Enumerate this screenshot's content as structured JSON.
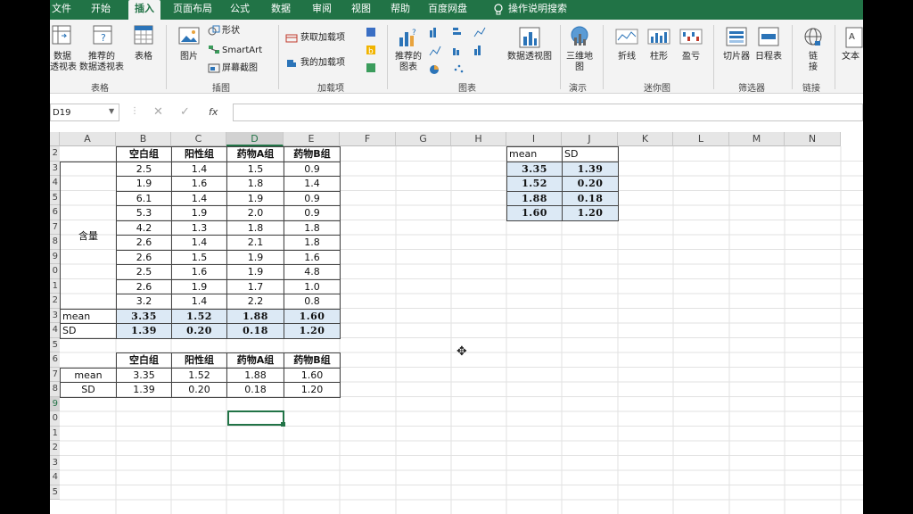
{
  "tabs": [
    "文件",
    "开始",
    "插入",
    "页面布局",
    "公式",
    "数据",
    "审阅",
    "视图",
    "帮助",
    "百度网盘",
    "操作说明搜索"
  ],
  "active_tab": "插入",
  "ribbon": {
    "pivot": "数据\n透视表",
    "recommended_pivot": "推荐的\n数据透视表",
    "table": "表格",
    "group_table": "表格",
    "picture": "图片",
    "shapes": "形状",
    "smartart": "SmartArt",
    "screenshot": "屏幕截图",
    "group_illustrations": "插图",
    "get_addins": "获取加载项",
    "my_addins": "我的加载项",
    "group_addins": "加载项",
    "recommended_charts": "推荐的\n图表",
    "pivot_chart": "数据透视图",
    "group_charts": "图表",
    "map3d": "三维地\n图",
    "group_tours": "演示",
    "line": "折线",
    "column": "柱形",
    "winloss": "盈亏",
    "group_sparklines": "迷你图",
    "slicer": "切片器",
    "timeline": "日程表",
    "group_filters": "筛选器",
    "link": "链\n接",
    "group_links": "链接",
    "text": "文本"
  },
  "namebox": "D19",
  "fx": "fx",
  "columns": [
    "A",
    "B",
    "C",
    "D",
    "E",
    "F",
    "G",
    "H",
    "I",
    "J",
    "K",
    "L",
    "M",
    "N"
  ],
  "selected_column": "D",
  "rows": [
    "2",
    "3",
    "4",
    "5",
    "6",
    "7",
    "8",
    "9",
    "0",
    "1",
    "2",
    "3",
    "4",
    "5",
    "6",
    "7",
    "8",
    "9",
    "0",
    "1",
    "2",
    "3",
    "4",
    "5"
  ],
  "selected_row_index": 17,
  "table1": {
    "headers": [
      "空白组",
      "阳性组",
      "药物A组",
      "药物B组"
    ],
    "group_label": "含量",
    "values": [
      [
        "2.5",
        "1.4",
        "1.5",
        "0.9"
      ],
      [
        "1.9",
        "1.6",
        "1.8",
        "1.4"
      ],
      [
        "6.1",
        "1.4",
        "1.9",
        "0.9"
      ],
      [
        "5.3",
        "1.9",
        "2.0",
        "0.9"
      ],
      [
        "4.2",
        "1.3",
        "1.8",
        "1.8"
      ],
      [
        "2.6",
        "1.4",
        "2.1",
        "1.8"
      ],
      [
        "2.6",
        "1.5",
        "1.9",
        "1.6"
      ],
      [
        "2.5",
        "1.6",
        "1.9",
        "4.8"
      ],
      [
        "2.6",
        "1.9",
        "1.7",
        "1.0"
      ],
      [
        "3.2",
        "1.4",
        "2.2",
        "0.8"
      ]
    ],
    "mean_label": "mean",
    "sd_label": "SD",
    "mean": [
      "3.35",
      "1.52",
      "1.88",
      "1.60"
    ],
    "sd": [
      "1.39",
      "0.20",
      "0.18",
      "1.20"
    ]
  },
  "table2": {
    "headers": [
      "空白组",
      "阳性组",
      "药物A组",
      "药物B组"
    ],
    "mean_label": "mean",
    "sd_label": "SD",
    "mean": [
      "3.35",
      "1.52",
      "1.88",
      "1.60"
    ],
    "sd": [
      "1.39",
      "0.20",
      "0.18",
      "1.20"
    ]
  },
  "table3": {
    "headers": [
      "mean",
      "SD"
    ],
    "rows": [
      [
        "3.35",
        "1.39"
      ],
      [
        "1.52",
        "0.20"
      ],
      [
        "1.88",
        "0.18"
      ],
      [
        "1.60",
        "1.20"
      ]
    ]
  },
  "colors": {
    "excel_green": "#217346",
    "highlight": "#dce9f5"
  }
}
